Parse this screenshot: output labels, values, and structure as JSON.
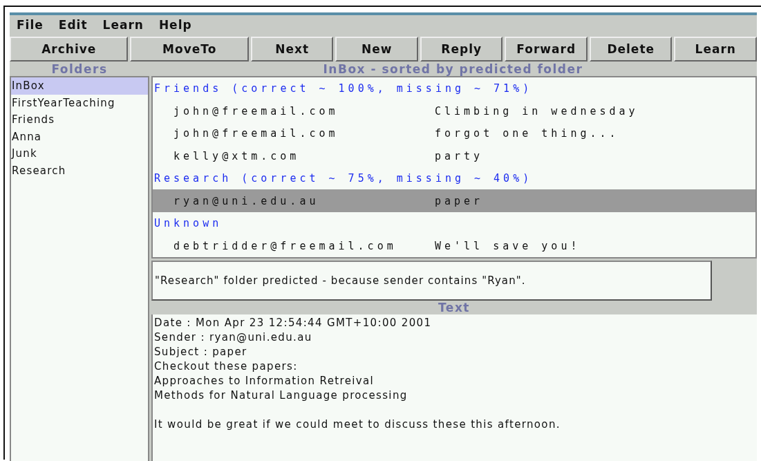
{
  "menu": [
    "File",
    "Edit",
    "Learn",
    "Help"
  ],
  "toolbar": [
    "Archive",
    "MoveTo",
    "Next",
    "New",
    "Reply",
    "Forward",
    "Delete",
    "Learn"
  ],
  "folders_heading": "Folders",
  "list_heading": "InBox - sorted by predicted folder",
  "folders": [
    {
      "label": "InBox",
      "selected": true
    },
    {
      "label": "FirstYearTeaching",
      "selected": false
    },
    {
      "label": "Friends",
      "selected": false
    },
    {
      "label": "Anna",
      "selected": false
    },
    {
      "label": "Junk",
      "selected": false
    },
    {
      "label": "Research",
      "selected": false
    }
  ],
  "groups": [
    {
      "header": "Friends (correct ~ 100%, missing ~ 71%)",
      "rows": [
        {
          "sender": "john@freemail.com",
          "subject": "Climbing in wednesday",
          "selected": false
        },
        {
          "sender": "john@freemail.com",
          "subject": "forgot one thing...",
          "selected": false
        },
        {
          "sender": "kelly@xtm.com",
          "subject": "party",
          "selected": false
        }
      ]
    },
    {
      "header": "Research (correct ~ 75%, missing ~ 40%)",
      "rows": [
        {
          "sender": "ryan@uni.edu.au",
          "subject": "paper",
          "selected": true
        }
      ]
    },
    {
      "header": "Unknown",
      "rows": [
        {
          "sender": "debtridder@freemail.com",
          "subject": "We'll save you!",
          "selected": false
        }
      ]
    }
  ],
  "explanation": "\"Research\" folder predicted - because sender contains \"Ryan\".",
  "text_heading": "Text",
  "body": [
    [
      "Date : Mon Apr 23 12:54:44 GMT+10:00 2001",
      "Sender : ryan@uni.edu.au",
      "Subject : paper",
      "Checkout these papers:",
      "Approaches to Information Retreival",
      "Methods for Natural Language processing"
    ],
    [
      "It would be great if we could meet to discuss these this afternoon."
    ]
  ]
}
